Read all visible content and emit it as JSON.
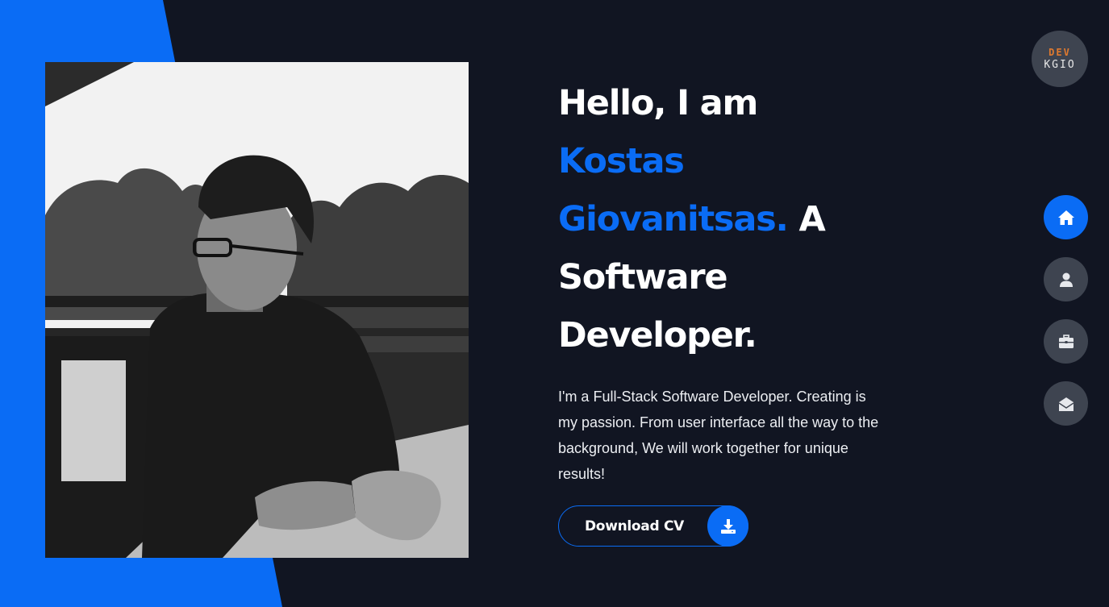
{
  "logo": {
    "line1": "DEV",
    "line2": "KGIO"
  },
  "hero": {
    "greeting": "Hello, I am",
    "name_line1": "Kostas",
    "name_line2": "Giovanitsas.",
    "role_a": "A",
    "role_line1": "Software",
    "role_line2": "Developer.",
    "intro": "I'm a Full-Stack Software Developer. Creating is my passion. From user interface all the way to the background, We will work together for unique results!"
  },
  "cta": {
    "download_label": "Download CV"
  },
  "nav": {
    "items": [
      {
        "icon": "home-icon",
        "active": true
      },
      {
        "icon": "user-icon",
        "active": false
      },
      {
        "icon": "briefcase-icon",
        "active": false
      },
      {
        "icon": "envelope-open-icon",
        "active": false
      }
    ]
  },
  "colors": {
    "accent": "#0a6cf5",
    "background": "#111522",
    "nav_inactive": "#3e4450",
    "logo_accent": "#e07a2f"
  }
}
